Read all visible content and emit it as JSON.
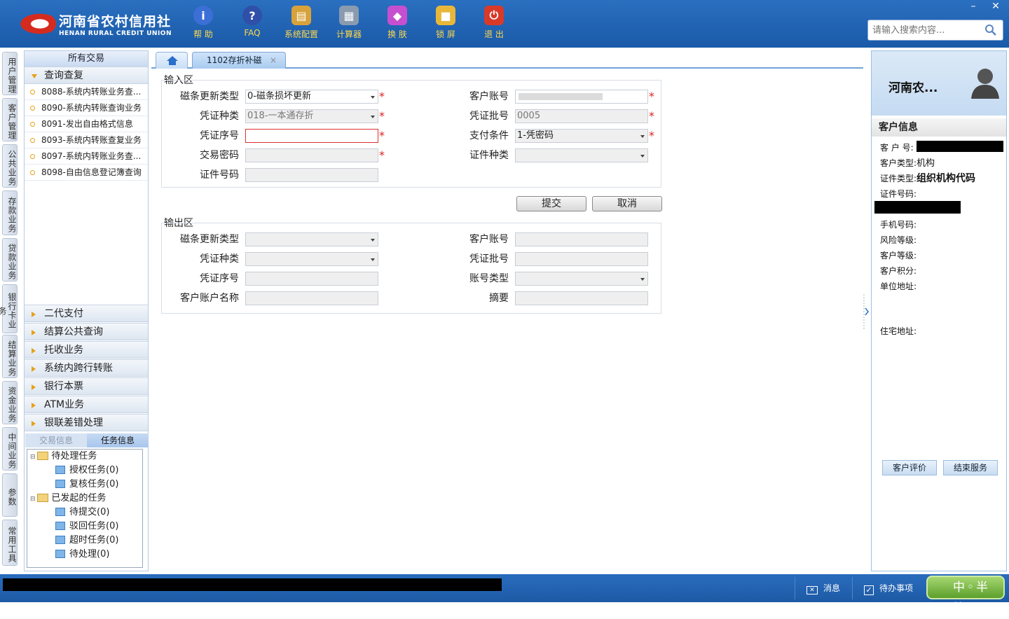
{
  "brand": {
    "name_cn": "河南省农村信用社",
    "name_en": "HENAN RURAL CREDIT UNION"
  },
  "toolbar": [
    {
      "label": "帮 助",
      "icon": "info-icon",
      "color": "#3b6fd6"
    },
    {
      "label": "FAQ",
      "icon": "question-icon",
      "color": "#2f4fa8"
    },
    {
      "label": "系统配置",
      "icon": "toolbox-icon",
      "color": "#d8a23a"
    },
    {
      "label": "计算器",
      "icon": "calculator-icon",
      "color": "#8a9bb0"
    },
    {
      "label": "换 肤",
      "icon": "shirt-icon",
      "color": "#c64fd0"
    },
    {
      "label": "锁 屏",
      "icon": "lock-icon",
      "color": "#e8b73a"
    },
    {
      "label": "退 出",
      "icon": "power-icon",
      "color": "#d83a2a"
    }
  ],
  "search": {
    "placeholder": "请输入搜索内容..."
  },
  "window": {
    "minimize": "–",
    "close": "✕"
  },
  "vtabs": [
    "用户管理",
    "客户管理",
    "公共业务",
    "存款业务",
    "贷款业务",
    "银行卡业务",
    "结算业务",
    "资金业务",
    "中间业务",
    "参数",
    "常用工具"
  ],
  "nav": {
    "header": "所有交易",
    "open_group": "查询查复",
    "items": [
      "8088-系统内转账业务查...",
      "8090-系统内转账查询业务",
      "8091-发出自由格式信息",
      "8093-系统内转账查复业务",
      "8097-系统内转账业务查...",
      "8098-自由信息登记簿查询"
    ],
    "groups": [
      "二代支付",
      "结算公共查询",
      "托收业务",
      "系统内跨行转账",
      "银行本票",
      "ATM业务",
      "银联差错处理"
    ]
  },
  "tasks": {
    "tab_trade": "交易信息",
    "tab_task": "任务信息",
    "pending": "待处理任务",
    "auth": "授权任务(0)",
    "review": "复核任务(0)",
    "initiated": "已发起的任务",
    "to_submit": "待提交(0)",
    "rejected": "驳回任务(0)",
    "timeout": "超时任务(0)",
    "to_process": "待处理(0)"
  },
  "tabs": {
    "active": "1102存折补磁",
    "close": "×"
  },
  "input": {
    "legend": "输入区",
    "mag_type_label": "磁条更新类型",
    "mag_type_value": "0-磁条损坏更新",
    "account_label": "客户账号",
    "account_value": "",
    "voucher_type_label": "凭证种类",
    "voucher_type_value": "018-一本通存折",
    "batch_label": "凭证批号",
    "batch_value": "0005",
    "voucher_no_label": "凭证序号",
    "voucher_no_value": "",
    "pay_cond_label": "支付条件",
    "pay_cond_value": "1-凭密码",
    "password_label": "交易密码",
    "id_type_label": "证件种类",
    "id_no_label": "证件号码"
  },
  "buttons": {
    "submit": "提交",
    "cancel": "取消"
  },
  "output": {
    "legend": "输出区",
    "mag_type_label": "磁条更新类型",
    "account_label": "客户账号",
    "voucher_type_label": "凭证种类",
    "batch_label": "凭证批号",
    "voucher_no_label": "凭证序号",
    "acct_type_label": "账号类型",
    "acct_name_label": "客户账户名称",
    "summary_label": "摘要"
  },
  "customer": {
    "name": "河南农...",
    "section": "客户信息",
    "no_label": "客 户 号:",
    "type_label": "客户类型:",
    "type_value": "机构",
    "id_type_label": "证件类型:",
    "id_type_value": "组织机构代码",
    "id_no_label": "证件号码:",
    "phone_label": "手机号码:",
    "risk_label": "风险等级:",
    "level_label": "客户等级:",
    "points_label": "客户积分:",
    "work_addr_label": "单位地址:",
    "home_addr_label": "住宅地址:",
    "eval_button": "客户评价",
    "end_button": "结束服务"
  },
  "status": {
    "message": "消息",
    "todo": "待办事项",
    "ime": "中◦半简"
  }
}
